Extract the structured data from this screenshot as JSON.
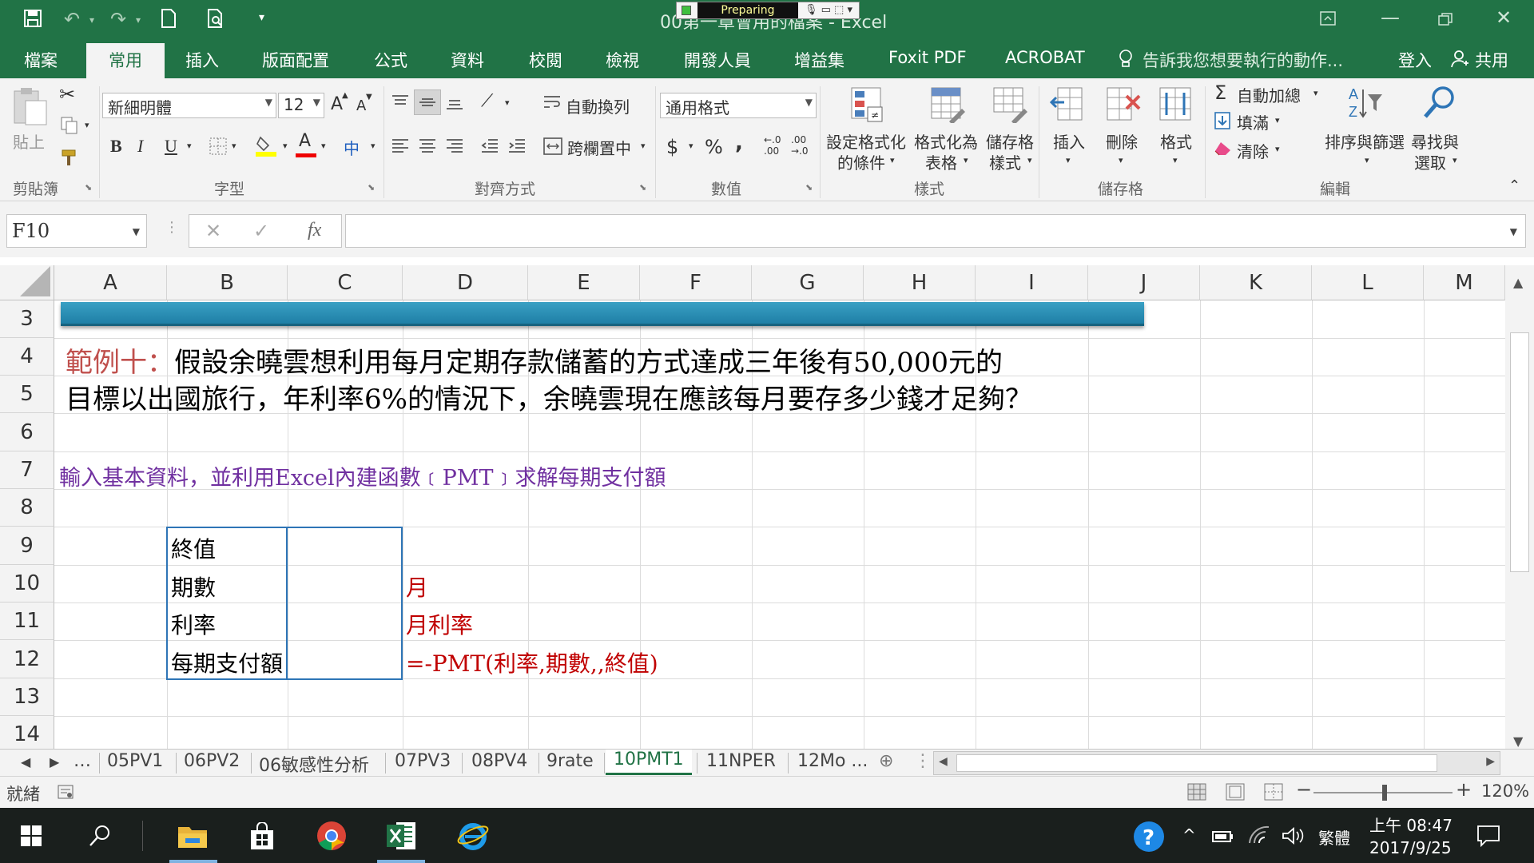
{
  "window": {
    "title": "00第一章會用的檔案 - Excel",
    "recorder_label": "Preparing",
    "sign_in": "登入",
    "share": "共用"
  },
  "ribbon_tabs": [
    "檔案",
    "常用",
    "插入",
    "版面配置",
    "公式",
    "資料",
    "校閱",
    "檢視",
    "開發人員",
    "增益集",
    "Foxit PDF",
    "ACROBAT"
  ],
  "active_tab": "常用",
  "tell_me": "告訴我您想要執行的動作...",
  "clipboard": {
    "paste": "貼上",
    "group": "剪貼簿"
  },
  "font": {
    "name": "新細明體",
    "size": "12",
    "bold": "B",
    "italic": "I",
    "underline": "U",
    "group": "字型",
    "phonetic": "中",
    "grow": "A",
    "shrink": "A",
    "font_color": "A"
  },
  "alignment": {
    "wrap": "自動換列",
    "merge": "跨欄置中",
    "group": "對齊方式"
  },
  "number": {
    "format": "通用格式",
    "currency": "$",
    "percent": "%",
    "comma": ",",
    "group": "數值"
  },
  "styles": {
    "cond_format_1": "設定格式化",
    "cond_format_2": "的條件",
    "table_1": "格式化為",
    "table_2": "表格",
    "cell_1": "儲存格",
    "cell_2": "樣式",
    "group": "樣式"
  },
  "cells": {
    "insert": "插入",
    "delete": "刪除",
    "format": "格式",
    "group": "儲存格"
  },
  "editing": {
    "autosum": "自動加總",
    "fill": "填滿",
    "clear": "清除",
    "sort": "排序與篩選",
    "find_1": "尋找與",
    "find_2": "選取",
    "group": "編輯"
  },
  "formula_bar": {
    "name_box": "F10",
    "fx": "fx",
    "formula": ""
  },
  "columns": [
    "A",
    "B",
    "C",
    "D",
    "E",
    "F",
    "G",
    "H",
    "I",
    "J",
    "K",
    "L",
    "M"
  ],
  "rows": [
    "3",
    "4",
    "5",
    "6",
    "7",
    "8",
    "9",
    "10",
    "11",
    "12",
    "13",
    "14"
  ],
  "content": {
    "example_label": "範例十：",
    "line1": "假設余曉雲想利用每月定期存款儲蓄的方式達成三年後有50,000元的",
    "line2": "目標以出國旅行，年利率6%的情況下，余曉雲現在應該每月要存多少錢才足夠？",
    "instruction": "輸入基本資料，並利用Excel內建函數﹝PMT﹞求解每期支付額",
    "labels": [
      "終值",
      "期數",
      "利率",
      "每期支付額"
    ],
    "notes": {
      "d10": "月",
      "d11": "月利率",
      "d12": "=-PMT(利率,期數,,終值)"
    }
  },
  "sheet_tabs": [
    "05PV1",
    "06PV2",
    "06敏感性分析",
    "07PV3",
    "08PV4",
    "9rate",
    "10PMT1",
    "11NPER",
    "12Mo ..."
  ],
  "active_sheet": "10PMT1",
  "status": {
    "ready": "就緒",
    "zoom": "120%"
  },
  "taskbar": {
    "ime": "繁體",
    "time": "上午 08:47",
    "date": "2017/9/25"
  },
  "colors": {
    "excel_green": "#217346",
    "banner": "#2e8fb7",
    "purple_text": "#7030a0",
    "red_text": "#c00000",
    "label_red": "#c0504d"
  }
}
